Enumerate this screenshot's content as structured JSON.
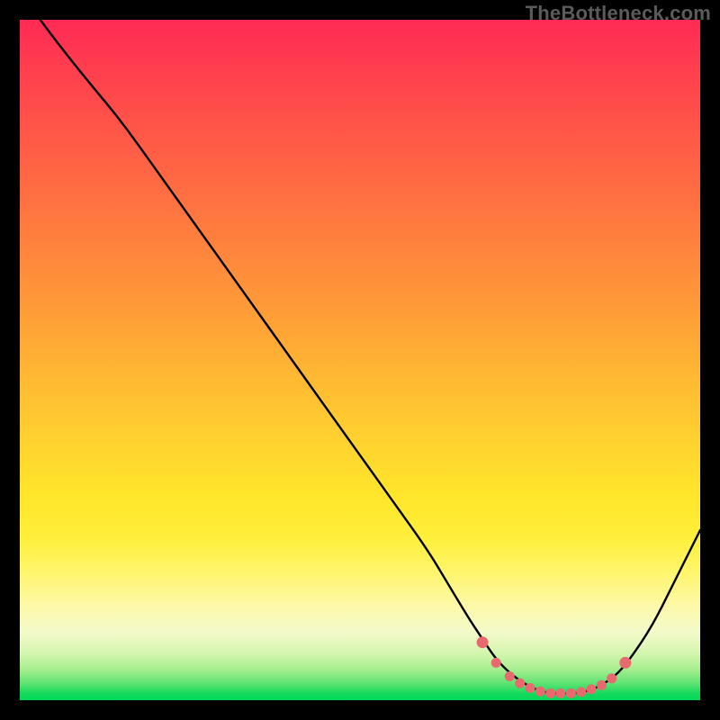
{
  "watermark": "TheBottleneck.com",
  "colors": {
    "dot": "#e86a6f",
    "curve": "#000000",
    "gradient_top": "#ff2a55",
    "gradient_bottom": "#00d85a"
  },
  "chart_data": {
    "type": "line",
    "title": "",
    "xlabel": "",
    "ylabel": "",
    "xlim": [
      0,
      100
    ],
    "ylim": [
      0,
      100
    ],
    "grid": false,
    "legend": false,
    "series": [
      {
        "name": "bottleneck-curve",
        "x": [
          3,
          6,
          10,
          15,
          20,
          25,
          30,
          35,
          40,
          45,
          50,
          55,
          60,
          63,
          66,
          68,
          70,
          72,
          74,
          76,
          78,
          80,
          82,
          84,
          86,
          88,
          90,
          93,
          96,
          100
        ],
        "y": [
          100,
          96,
          91,
          85,
          78,
          71,
          64,
          57,
          50,
          43,
          36,
          29,
          22,
          17,
          12,
          9,
          6,
          4,
          2.5,
          1.5,
          1,
          1,
          1,
          1.5,
          2.5,
          4,
          6.5,
          11,
          17,
          25
        ]
      }
    ],
    "highlight_points": {
      "name": "optimal-range-markers",
      "x": [
        68,
        70,
        72,
        73.5,
        75,
        76.5,
        78,
        79.5,
        81,
        82.5,
        84,
        85.5,
        87,
        89
      ],
      "y": [
        8.5,
        5.5,
        3.5,
        2.5,
        1.8,
        1.3,
        1,
        1,
        1,
        1.2,
        1.6,
        2.2,
        3.2,
        5.5
      ]
    }
  }
}
